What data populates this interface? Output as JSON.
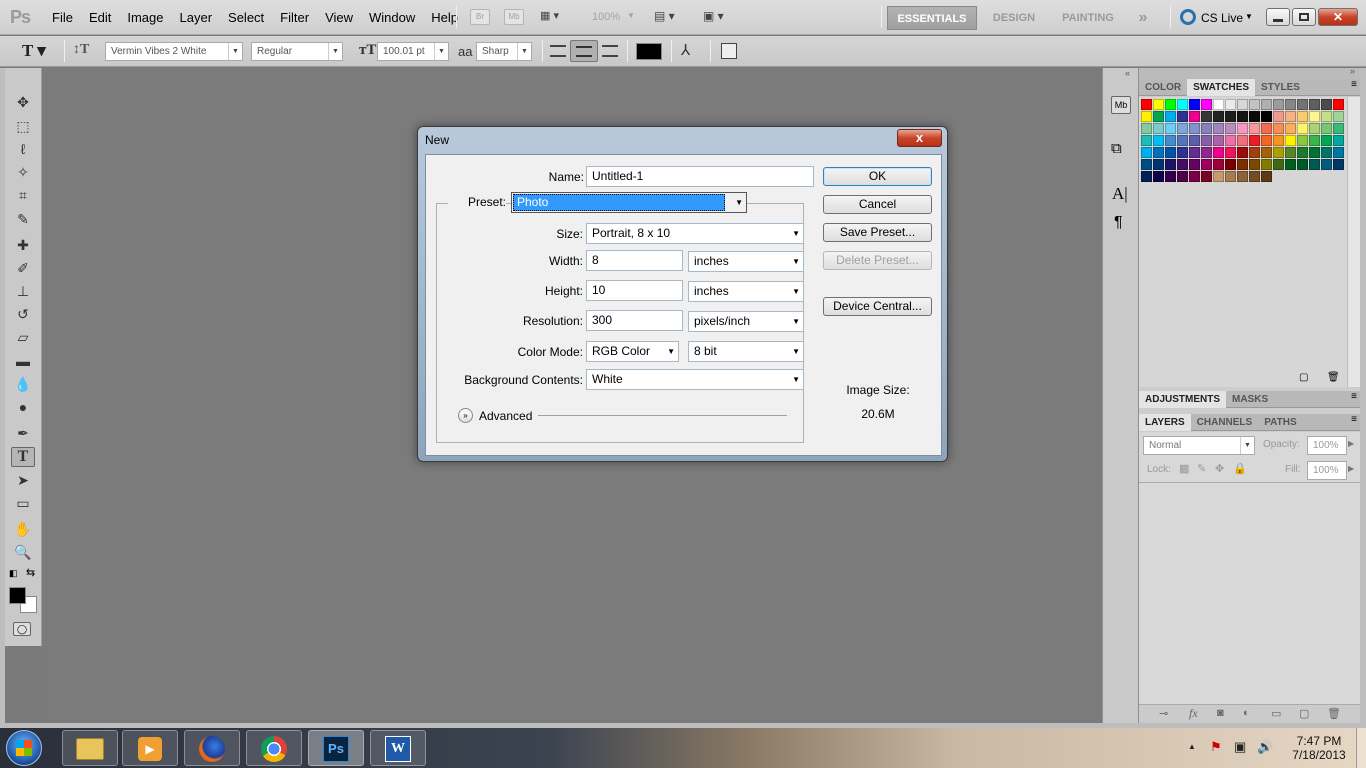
{
  "app": {
    "logo": "Ps"
  },
  "menu": [
    "File",
    "Edit",
    "Image",
    "Layer",
    "Select",
    "Filter",
    "View",
    "Window",
    "Help"
  ],
  "appbar": {
    "bridge": "Br",
    "minibridge": "Mb",
    "zoom": "100%"
  },
  "workspaces": {
    "essentials": "ESSENTIALS",
    "design": "DESIGN",
    "painting": "PAINTING",
    "more": "»",
    "cslive": "CS Live"
  },
  "options": {
    "font_family": "Vermin Vibes 2 White",
    "font_style": "Regular",
    "font_size": "100.01 pt",
    "aa_icon": "aa",
    "antialias": "Sharp",
    "color": "#000000"
  },
  "panels": {
    "swatch_tabs": [
      "COLOR",
      "SWATCHES",
      "STYLES"
    ],
    "adjust_tabs": [
      "ADJUSTMENTS",
      "MASKS"
    ],
    "layer_tabs": [
      "LAYERS",
      "CHANNELS",
      "PATHS"
    ],
    "blend_mode": "Normal",
    "opacity_label": "Opacity:",
    "opacity": "100%",
    "lock_label": "Lock:",
    "fill_label": "Fill:",
    "fill": "100%"
  },
  "dialog": {
    "title": "New",
    "close": "x",
    "name_label": "Name:",
    "name_value": "Untitled-1",
    "preset_label": "Preset:",
    "preset_value": "Photo",
    "size_label": "Size:",
    "size_value": "Portrait, 8 x 10",
    "width_label": "Width:",
    "width_value": "8",
    "width_unit": "inches",
    "height_label": "Height:",
    "height_value": "10",
    "height_unit": "inches",
    "resolution_label": "Resolution:",
    "resolution_value": "300",
    "resolution_unit": "pixels/inch",
    "colormode_label": "Color Mode:",
    "colormode_value": "RGB Color",
    "bitdepth": "8 bit",
    "bg_label": "Background Contents:",
    "bg_value": "White",
    "advanced": "Advanced",
    "ok": "OK",
    "cancel": "Cancel",
    "save_preset": "Save Preset...",
    "delete_preset": "Delete Preset...",
    "device_central": "Device Central...",
    "image_size_label": "Image Size:",
    "image_size_value": "20.6M"
  },
  "dock_labels": {
    "mb": "Mb",
    "char": "A|",
    "para": "¶"
  },
  "taskbar": {
    "time": "7:47 PM",
    "date": "7/18/2013",
    "ps_label": "Ps",
    "word_label": "W"
  },
  "swatches": [
    "#ff0000",
    "#ffff00",
    "#00ff00",
    "#00ffff",
    "#0000ff",
    "#ff00ff",
    "#ffffff",
    "#ebebeb",
    "#d7d7d7",
    "#c3c3c3",
    "#afafaf",
    "#9b9b9b",
    "#878787",
    "#737373",
    "#5f5f5f",
    "#4b4b4b",
    "#ff0000",
    "#fff200",
    "#00a651",
    "#00aeef",
    "#2e3192",
    "#ec008c",
    "#373737",
    "#232323",
    "#1e1e1e",
    "#141414",
    "#0a0a0a",
    "#000000",
    "#ef9a8c",
    "#f4b183",
    "#f9cd6b",
    "#fff68f",
    "#c6df8b",
    "#a1d39c",
    "#82ca9c",
    "#7accc8",
    "#6dcff6",
    "#7da7d9",
    "#8393ca",
    "#8781bd",
    "#a186be",
    "#bd8cbf",
    "#f49ac1",
    "#f5989d",
    "#f26c4f",
    "#f68e56",
    "#fbaf5d",
    "#fff467",
    "#acd373",
    "#7cc576",
    "#3cb878",
    "#1cbbb4",
    "#00bff3",
    "#448ccb",
    "#5574b9",
    "#605ca8",
    "#8560a8",
    "#a864a8",
    "#f06eaa",
    "#f26d7d",
    "#ed1c24",
    "#f26522",
    "#f7941d",
    "#fff200",
    "#8dc63f",
    "#39b54a",
    "#00a651",
    "#00a99d",
    "#00aeef",
    "#0072bc",
    "#0054a6",
    "#2e3192",
    "#662d91",
    "#92278f",
    "#ec008c",
    "#ed145b",
    "#9e0b0f",
    "#a0410d",
    "#a36209",
    "#aba000",
    "#598527",
    "#1a7b30",
    "#007236",
    "#00746b",
    "#0076a3",
    "#004b80",
    "#003471",
    "#1b1464",
    "#440e62",
    "#630460",
    "#9e005d",
    "#9e0039",
    "#790000",
    "#7b2e00",
    "#7d4900",
    "#827b00",
    "#406618",
    "#005e20",
    "#005826",
    "#005952",
    "#005b7f",
    "#003663",
    "#002157",
    "#0d004c",
    "#32004b",
    "#4b0049",
    "#7b0046",
    "#7a0026",
    "#c69c6d",
    "#a67c52",
    "#8c6239",
    "#754c24",
    "#603913"
  ]
}
